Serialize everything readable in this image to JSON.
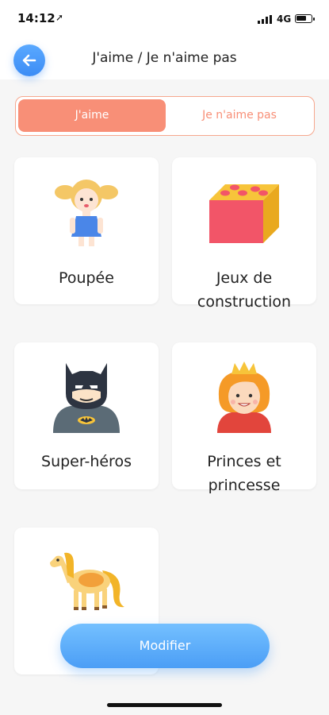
{
  "status_bar": {
    "time": "14:12",
    "network": "4G"
  },
  "header": {
    "title": "J'aime / Je n'aime pas"
  },
  "tabs": [
    {
      "label": "J'aime",
      "active": true
    },
    {
      "label": "Je n'aime pas",
      "active": false
    }
  ],
  "cards": [
    {
      "label": "Poupée",
      "icon": "doll-icon"
    },
    {
      "label_line1": "Jeux de",
      "label_line2": "construction",
      "icon": "building-block-icon"
    },
    {
      "label": "Super-héros",
      "icon": "superhero-icon"
    },
    {
      "label_line1": "Princes et",
      "label_line2": "princesse",
      "icon": "princess-icon"
    },
    {
      "label": "",
      "icon": "horse-icon"
    }
  ],
  "actions": {
    "modify_label": "Modifier"
  },
  "colors": {
    "accent": "#f88f77",
    "primary": "#4b9ef6"
  }
}
